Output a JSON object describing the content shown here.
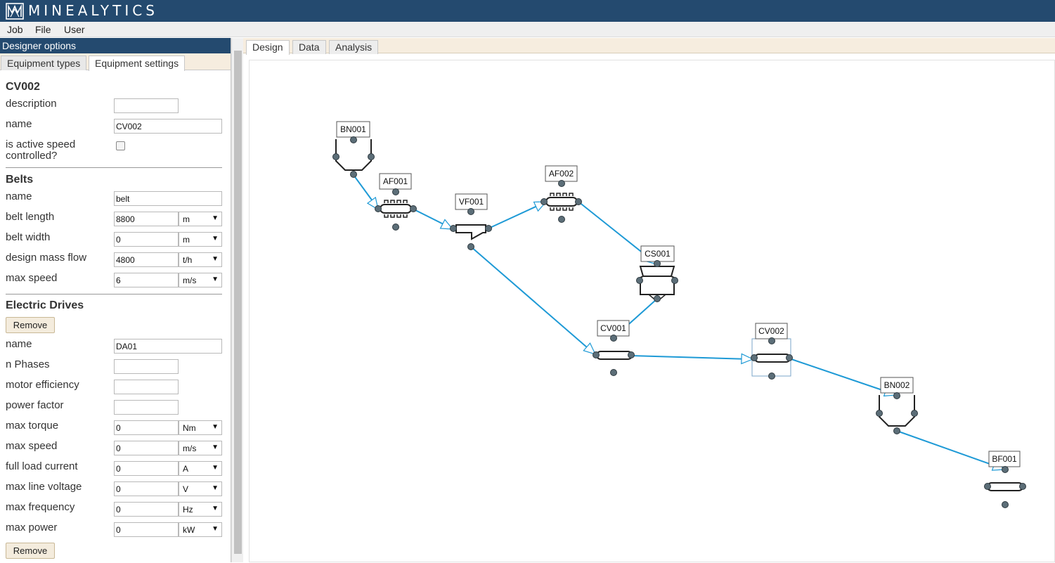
{
  "app": {
    "name": "MINEALYTICS"
  },
  "menu": {
    "items": [
      "Job",
      "File",
      "User"
    ]
  },
  "left_panel": {
    "title": "Designer options",
    "tabs": [
      "Equipment types",
      "Equipment settings"
    ],
    "active_tab": "Equipment settings",
    "equipment": {
      "id": "CV002",
      "description_label": "description",
      "description_value": "",
      "name_label": "name",
      "name_value": "CV002",
      "speed_label_1": "is active speed",
      "speed_label_2": "controlled?",
      "speed_checked": false
    },
    "belts": {
      "title": "Belts",
      "fields": [
        {
          "label": "name",
          "value": "belt",
          "unit": ""
        },
        {
          "label": "belt length",
          "value": "8800",
          "unit": "m"
        },
        {
          "label": "belt width",
          "value": "0",
          "unit": "m"
        },
        {
          "label": "design mass flow",
          "value": "4800",
          "unit": "t/h"
        },
        {
          "label": "max speed",
          "value": "6",
          "unit": "m/s"
        }
      ]
    },
    "drives": {
      "title": "Electric Drives",
      "remove_label": "Remove",
      "fields": [
        {
          "label": "name",
          "value": "DA01",
          "unit": ""
        },
        {
          "label": "n Phases",
          "value": "",
          "unit": ""
        },
        {
          "label": "motor efficiency",
          "value": "",
          "unit": ""
        },
        {
          "label": "power factor",
          "value": "",
          "unit": ""
        },
        {
          "label": "max torque",
          "value": "0",
          "unit": "Nm"
        },
        {
          "label": "max speed",
          "value": "0",
          "unit": "m/s"
        },
        {
          "label": "full load current",
          "value": "0",
          "unit": "A"
        },
        {
          "label": "max line voltage",
          "value": "0",
          "unit": "V"
        },
        {
          "label": "max frequency",
          "value": "0",
          "unit": "Hz"
        },
        {
          "label": "max power",
          "value": "0",
          "unit": "kW"
        }
      ],
      "remove_label_2": "Remove"
    }
  },
  "right_tabs": [
    "Design",
    "Data",
    "Analysis"
  ],
  "active_right_tab": "Design",
  "diagram": {
    "nodes": [
      "BN001",
      "AF001",
      "VF001",
      "AF002",
      "CS001",
      "CV001",
      "CV002",
      "BN002",
      "BF001"
    ],
    "selected_node": "CV002",
    "connections": [
      [
        "BN001",
        "AF001"
      ],
      [
        "AF001",
        "VF001"
      ],
      [
        "VF001",
        "AF002"
      ],
      [
        "AF002",
        "CS001"
      ],
      [
        "VF001",
        "CV001"
      ],
      [
        "CS001",
        "CV001"
      ],
      [
        "CV001",
        "CV002"
      ],
      [
        "CV002",
        "BN002"
      ],
      [
        "BN002",
        "BF001"
      ]
    ]
  },
  "colors": {
    "header_bg": "#244a6f",
    "tab_bar_bg": "#f6eddf",
    "connector_line": "#1e9ad6",
    "port_fill": "#5c6e78"
  }
}
